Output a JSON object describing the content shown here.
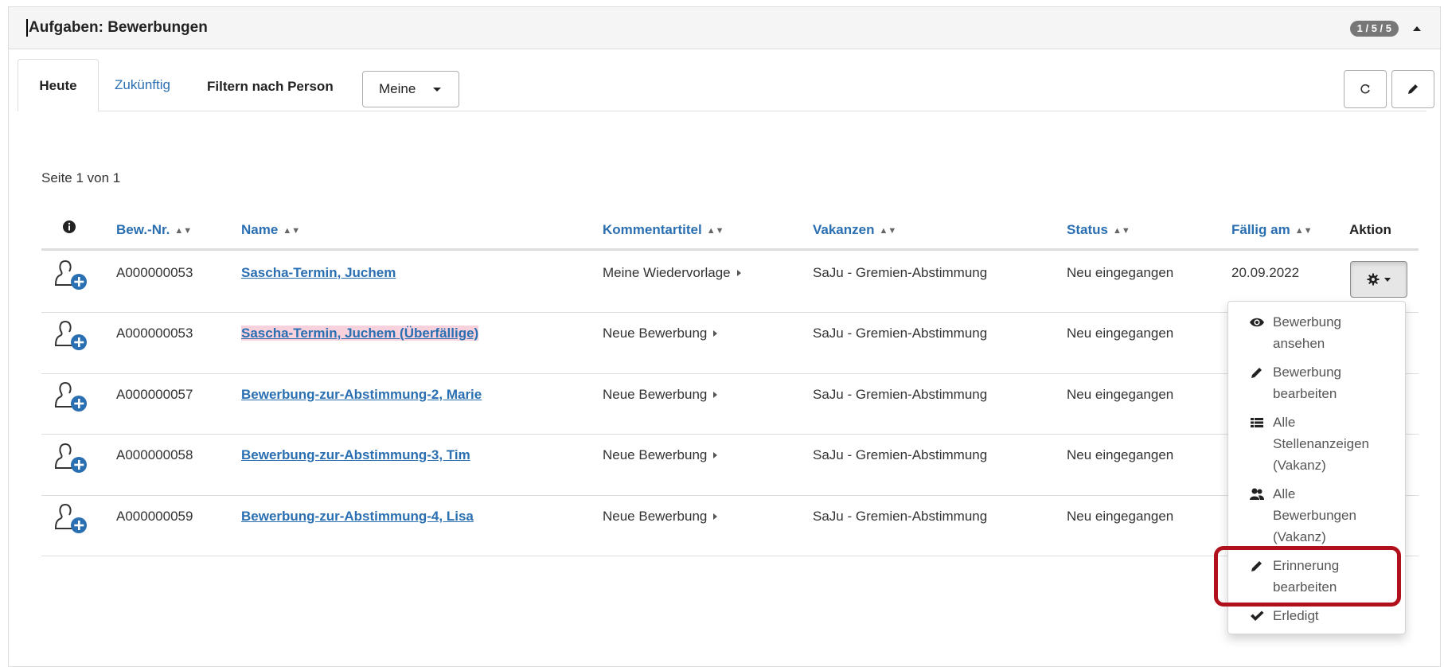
{
  "panel": {
    "title": "Aufgaben: Bewerbungen",
    "badge": "1 / 5 / 5"
  },
  "tabs": [
    {
      "label": "Heute",
      "active": true
    },
    {
      "label": "Zukünftig",
      "active": false
    }
  ],
  "filter": {
    "label": "Filtern nach Person",
    "selected": "Meine"
  },
  "toolbar": {
    "refresh_icon": "refresh-icon",
    "edit_icon": "pencil-icon"
  },
  "pagination": {
    "text": "Seite 1 von 1"
  },
  "table": {
    "columns": {
      "info_icon": "info-circle-icon",
      "number": "Bew.-Nr.",
      "name": "Name",
      "comment": "Kommentartitel",
      "vacancy": "Vakanzen",
      "status": "Status",
      "due": "Fällig am",
      "action": "Aktion"
    },
    "rows": [
      {
        "number": "A000000053",
        "name": "Sascha-Termin, Juchem",
        "overdue": false,
        "comment": "Meine Wiedervorlage",
        "vacancy": "SaJu - Gremien-Abstimmung",
        "status": "Neu eingegangen",
        "due": "20.09.2022"
      },
      {
        "number": "A000000053",
        "name": "Sascha-Termin, Juchem (Überfällige)",
        "overdue": true,
        "comment": "Neue Bewerbung",
        "vacancy": "SaJu - Gremien-Abstimmung",
        "status": "Neu eingegangen",
        "due": ""
      },
      {
        "number": "A000000057",
        "name": "Bewerbung-zur-Abstimmung-2, Marie",
        "overdue": false,
        "comment": "Neue Bewerbung",
        "vacancy": "SaJu - Gremien-Abstimmung",
        "status": "Neu eingegangen",
        "due": ""
      },
      {
        "number": "A000000058",
        "name": "Bewerbung-zur-Abstimmung-3, Tim",
        "overdue": false,
        "comment": "Neue Bewerbung",
        "vacancy": "SaJu - Gremien-Abstimmung",
        "status": "Neu eingegangen",
        "due": ""
      },
      {
        "number": "A000000059",
        "name": "Bewerbung-zur-Abstimmung-4, Lisa",
        "overdue": false,
        "comment": "Neue Bewerbung",
        "vacancy": "SaJu - Gremien-Abstimmung",
        "status": "Neu eingegangen",
        "due": ""
      }
    ]
  },
  "action_menu": {
    "button_icon": "gear-icon",
    "items": [
      {
        "icon": "eye-icon",
        "lines": [
          "Bewerbung",
          "ansehen"
        ]
      },
      {
        "icon": "pencil-icon",
        "lines": [
          "Bewerbung",
          "bearbeiten"
        ]
      },
      {
        "icon": "list-icon",
        "lines": [
          "Alle",
          "Stellenanzeigen",
          "(Vakanz)"
        ]
      },
      {
        "icon": "users-icon",
        "lines": [
          "Alle",
          "Bewerbungen",
          "(Vakanz)"
        ]
      },
      {
        "icon": "pencil-icon",
        "lines": [
          "Erinnerung",
          "bearbeiten"
        ],
        "highlighted": true
      },
      {
        "icon": "check-icon",
        "lines": [
          "Erledigt"
        ]
      }
    ]
  },
  "colors": {
    "link": "#2a6fb1",
    "overdue_bg": "#f7d2dc",
    "highlight": "#b0101c"
  }
}
